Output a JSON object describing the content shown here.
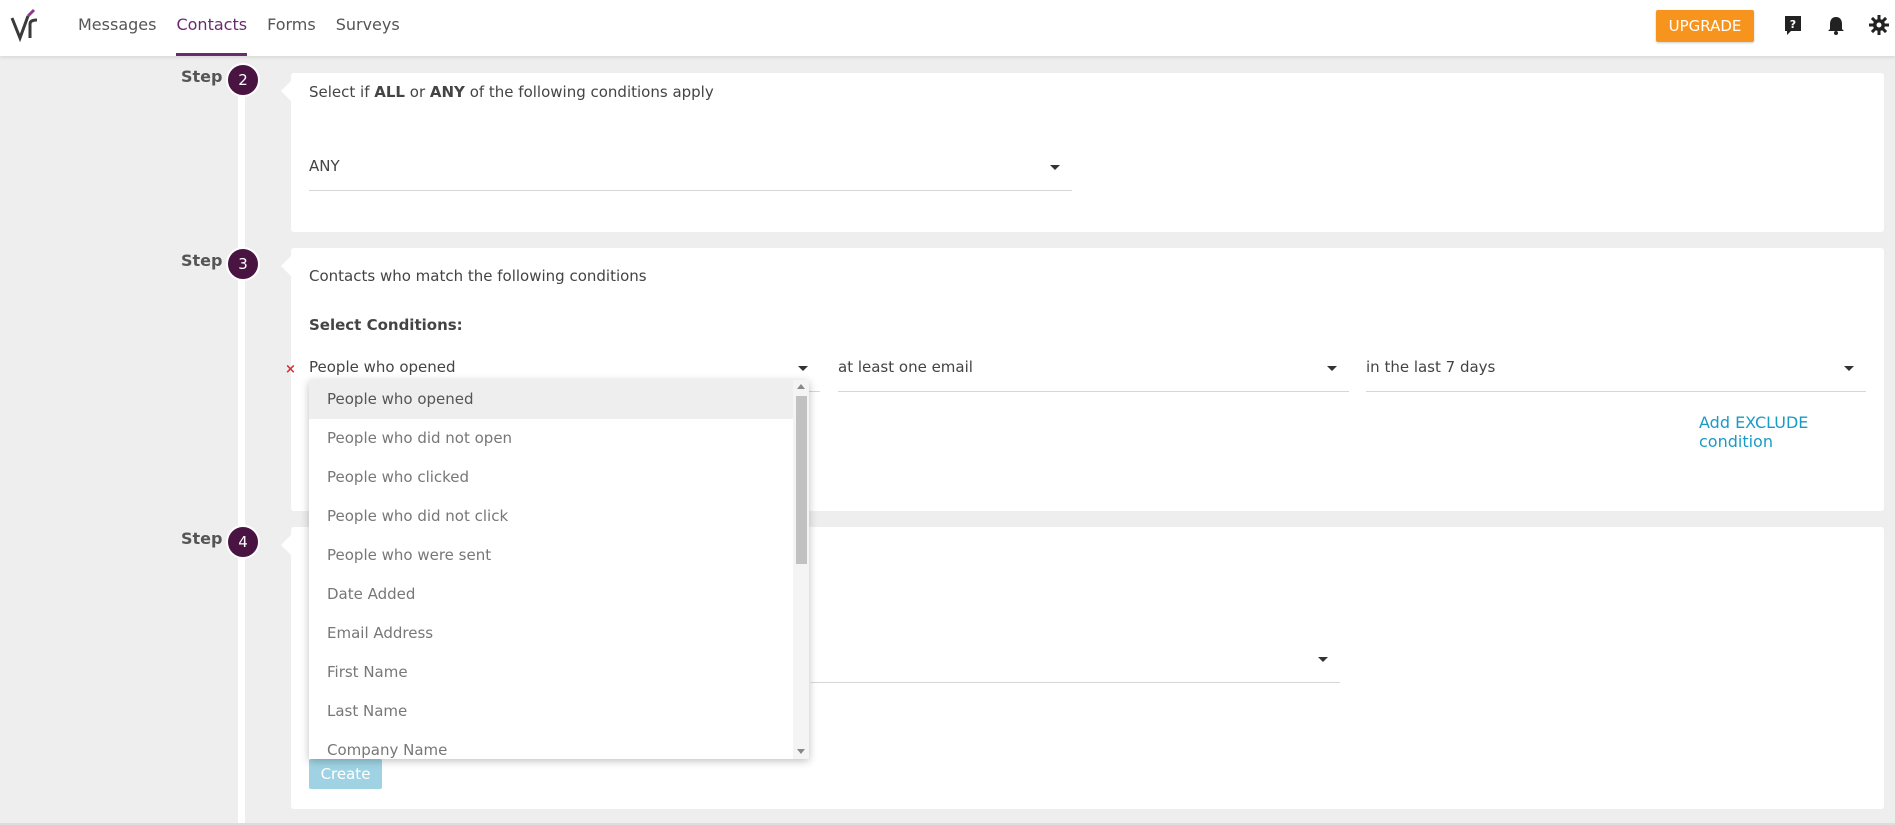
{
  "colors": {
    "brand": "#6b2a6e",
    "step": "#4a1442",
    "upgrade": "#f7941d",
    "link": "#1a9bc7",
    "create": "#9fd3e3"
  },
  "nav": {
    "items": [
      {
        "label": "Messages"
      },
      {
        "label": "Contacts"
      },
      {
        "label": "Forms"
      },
      {
        "label": "Surveys"
      }
    ],
    "active": "Contacts"
  },
  "header": {
    "upgrade_label": "UPGRADE",
    "icons": [
      "help-icon",
      "bell-icon",
      "gear-icon"
    ]
  },
  "steps": {
    "label": "Step",
    "step2": {
      "num": "2",
      "text_pre": "Select if ",
      "text_all": "ALL",
      "text_mid": " or ",
      "text_any": "ANY",
      "text_post": " of the following conditions apply",
      "select_value": "ANY"
    },
    "step3": {
      "num": "3",
      "title": "Contacts who match the following conditions",
      "select_conditions_label": "Select Conditions:",
      "condition_1": "People who opened",
      "condition_2": "at least one email",
      "condition_3": "in the last 7 days",
      "add_exclude_label": "Add EXCLUDE condition",
      "remove_label": "×"
    },
    "step4": {
      "num": "4",
      "create_label": "Create"
    }
  },
  "dropdown": {
    "options": [
      "People who opened",
      "People who did not open",
      "People who clicked",
      "People who did not click",
      "People who were sent",
      "Date Added",
      "Email Address",
      "First Name",
      "Last Name",
      "Company Name"
    ],
    "selected": "People who opened"
  }
}
